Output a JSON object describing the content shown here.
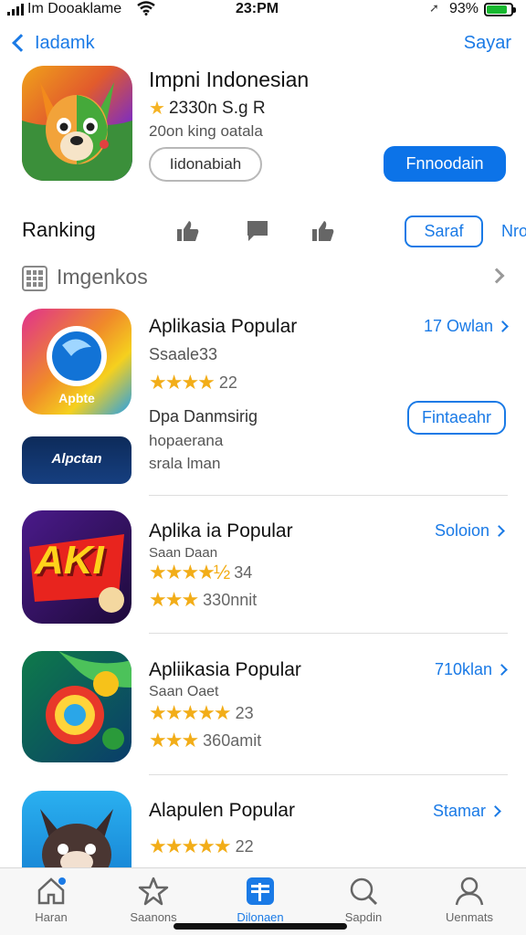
{
  "status_bar": {
    "carrier": "Im Dooaklame",
    "time": "23:PM",
    "battery_pct": "93%"
  },
  "nav": {
    "back_label": "Iadamk",
    "right_label": "Sayar"
  },
  "featured": {
    "title": "Impni Indonesian",
    "rating_text": "2330n S.g R",
    "subtitle": "20on king oatala",
    "secondary_button": "Iidonabiah",
    "primary_button": "Fnnoodain"
  },
  "ranking": {
    "label": "Ranking",
    "pill_label": "Saraf",
    "more_label": "Nro"
  },
  "section": {
    "title": "Imgenkos"
  },
  "apps": [
    {
      "name": "Aplikasia Popular",
      "subtitle": "Ssaale33",
      "rating_count": "22",
      "stars": 4,
      "link": "17 Owlan",
      "icon_text": "Apbte",
      "desc_title": "Dpa Danmsirig",
      "desc_line1": "hopaerana",
      "desc_line2": "srala lman",
      "button": "Fintaeahr",
      "extra_icon_text": "Alpctan"
    },
    {
      "name": "Aplika ia Popular",
      "subtitle": "Saan Daan",
      "rating_count": "34",
      "stars": 4.5,
      "second_rating": "330nnit",
      "second_stars": 3,
      "link": "Soloion",
      "icon_text": "AKI"
    },
    {
      "name": "Apliikasia Popular",
      "subtitle": "Saan Oaet",
      "rating_count": "23",
      "stars": 5,
      "second_rating": "360amit",
      "second_stars": 3,
      "link": "710klan"
    },
    {
      "name": "Alapulen Popular",
      "rating_count": "22",
      "stars": 5,
      "link": "Stamar"
    }
  ],
  "tabs": [
    {
      "label": "Haran",
      "icon": "home-icon"
    },
    {
      "label": "Saanons",
      "icon": "star-icon"
    },
    {
      "label": "Dilonaen",
      "icon": "apps-icon"
    },
    {
      "label": "Sapdin",
      "icon": "search-icon"
    },
    {
      "label": "Uenmats",
      "icon": "person-icon"
    }
  ],
  "colors": {
    "accent": "#1a7ae6",
    "star": "#f2ad18",
    "battery": "#17b82f"
  }
}
